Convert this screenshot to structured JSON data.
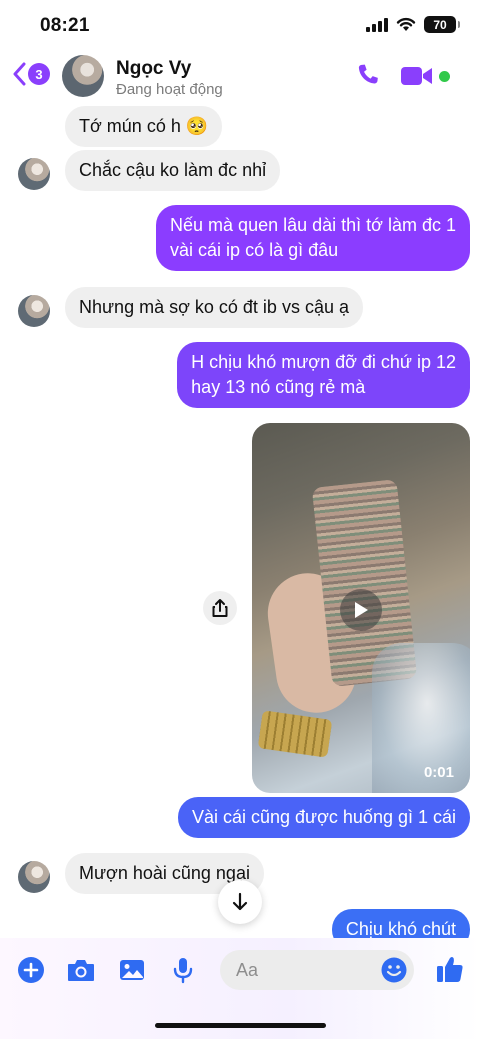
{
  "status_bar": {
    "time": "08:21",
    "battery": "70"
  },
  "header": {
    "unread_count": "3",
    "contact_name": "Ngọc Vy",
    "contact_status": "Đang hoạt động"
  },
  "colors": {
    "accent": "#8a3ffc",
    "bubble_out_purple": "#8b3dff",
    "bubble_out_blue": "#3b6ff5",
    "bubble_in": "#efefef",
    "online": "#31c94a"
  },
  "messages": [
    {
      "side": "in",
      "text": "Tớ mún có h 🥺",
      "avatar": false
    },
    {
      "side": "in",
      "text": "Chắc cậu ko làm đc nhỉ",
      "avatar": true
    },
    {
      "side": "out",
      "lines": [
        "Nếu mà quen lâu dài thì tớ làm đc 1",
        "vài cái ip có là gì đâu"
      ]
    },
    {
      "side": "in",
      "text": "Nhưng mà sợ ko có đt ib vs cậu ạ",
      "avatar": true
    },
    {
      "side": "out",
      "lines": [
        "H chịu khó mượn đỡ đi chứ ip 12",
        "hay 13 nó cũng rẻ mà"
      ]
    },
    {
      "side": "out",
      "type": "video",
      "duration": "0:01"
    },
    {
      "side": "out",
      "text": "Vài cái cũng được huống gì 1 cái"
    },
    {
      "side": "in",
      "text": "Mượn hoài cũng ngại",
      "avatar": true
    },
    {
      "side": "out",
      "text": "Chịu khó chút"
    }
  ],
  "composer": {
    "placeholder": "Aa"
  },
  "icons": [
    "back-chevron-icon",
    "phone-icon",
    "video-camera-icon",
    "share-icon",
    "play-icon",
    "arrow-down-icon",
    "plus-icon",
    "camera-icon",
    "image-icon",
    "microphone-icon",
    "emoji-icon",
    "thumbs-up-icon"
  ]
}
